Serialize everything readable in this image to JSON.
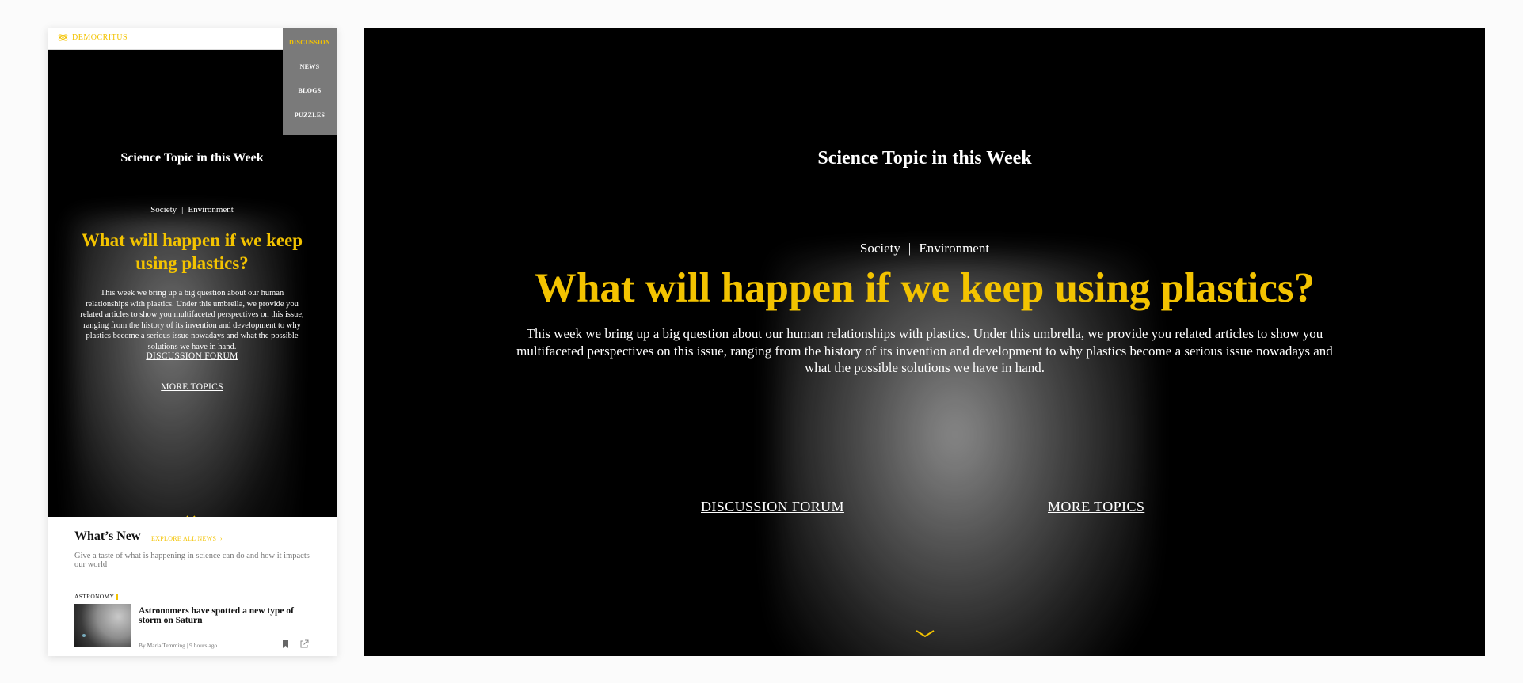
{
  "colors": {
    "accent": "#f3c300",
    "hero_bg": "#000000",
    "menu_bg": "#7a7a7a"
  },
  "mobile": {
    "brand": "DEMOCRITUS",
    "menu": [
      {
        "label": "DISCUSSION",
        "active": true
      },
      {
        "label": "NEWS"
      },
      {
        "label": "BLOGS"
      },
      {
        "label": "PUZZLES"
      }
    ],
    "hero": {
      "section_title": "Science Topic in this Week",
      "tag1": "Society",
      "tag_sep": "|",
      "tag2": "Environment",
      "headline": "What will happen if we keep using plastics?",
      "description": "This week we bring up a big question about our human relationships with plastics. Under this umbrella, we provide you related articles to show you multifaceted perspectives on this issue, ranging from the history of its invention and development to why plastics become a serious issue nowadays and what the possible solutions we have in hand.",
      "link_discussion": "DISCUSSION FORUM",
      "link_topics": "MORE TOPICS"
    },
    "news": {
      "title": "What’s New",
      "explore": "EXPLORE ALL NEWS",
      "description": "Give a taste of what is happening in science can do and how it impacts our world",
      "category": "ASTRONOMY",
      "article_title": "Astronomers have spotted a new type of storm on Saturn",
      "byline": "By Maria Temming | 9 hours ago"
    }
  },
  "desktop": {
    "section_title": "Science Topic in this Week",
    "tag1": "Society",
    "tag_sep": "|",
    "tag2": "Environment",
    "headline": "What will happen if we keep using plastics?",
    "description": "This week we bring up a big question about our human relationships with plastics. Under this umbrella, we provide you related articles to show you multifaceted perspectives on this issue, ranging from the history of its invention and development to why plastics become a serious issue nowadays and what the possible solutions we have in hand.",
    "link_discussion": "DISCUSSION FORUM",
    "link_topics": "MORE TOPICS"
  }
}
